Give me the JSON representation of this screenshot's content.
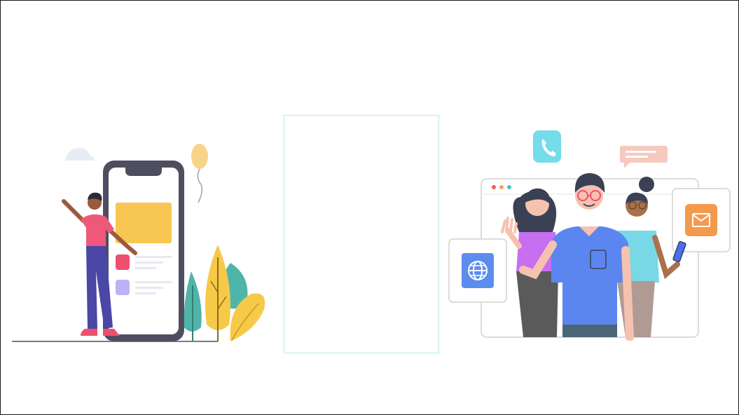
{
  "scene": {
    "background_color": "#ffffff",
    "frame_border_color": "#1a1a1a"
  },
  "left_illustration": {
    "icon": "person-with-smartphone-illustration",
    "colors": {
      "phone_frame": "#4f4e60",
      "screen": "#ffffff",
      "card": "#f7c653",
      "list_item_red": "#ef4f6e",
      "list_item_purple": "#c0b0f5",
      "list_line": "#e6e8f2",
      "shirt": "#f0587a",
      "pants": "#4a47a6",
      "skin": "#9a5a3c",
      "hair": "#2b2b3c",
      "tree_teal": "#4fb5a8",
      "tree_yellow": "#f7c948",
      "balloon": "#f7d488",
      "cloud": "#e8ecf3",
      "ground": "#7a7a86"
    }
  },
  "center_panel": {
    "icon": "blank-panel",
    "border_color": "#aeeef0"
  },
  "right_illustration": {
    "icon": "team-video-call-illustration",
    "colors": {
      "browser_border": "#dcdcdc",
      "dot_red": "#ef5b5b",
      "dot_orange": "#f2a54a",
      "dot_teal": "#4fc1b9",
      "phone_badge": "#74dcea",
      "chat_bubble": "#f6c9bd",
      "globe_badge": "#5b8def",
      "mail_badge": "#f39a4d",
      "man_shirt": "#5b86f0",
      "woman_left_shirt": "#c86ef0",
      "woman_right_shirt": "#78d8e6",
      "skin_light": "#f6c2b0",
      "skin_dark": "#a9714e",
      "hair_dark": "#3a4155"
    }
  }
}
